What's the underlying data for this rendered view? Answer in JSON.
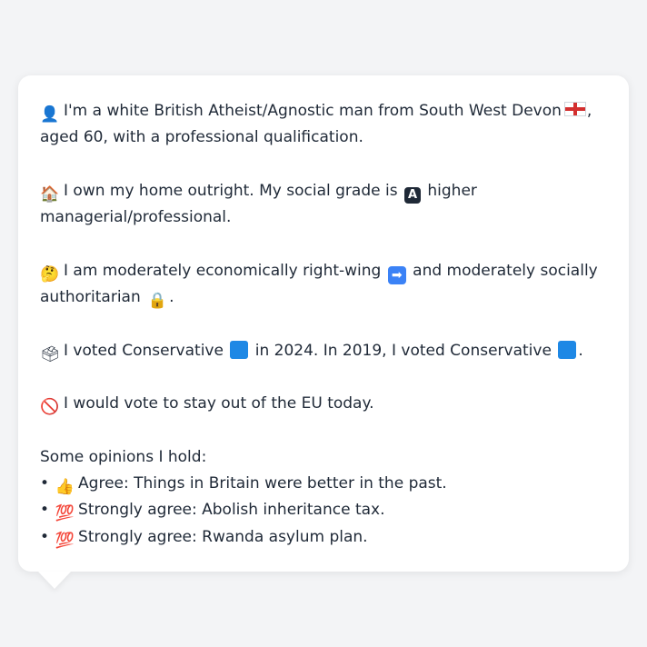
{
  "profile": {
    "line1a": "I'm a white British Atheist/Agnostic man from South West Devon",
    "line1b": ",",
    "line2": "aged 60, with a professional qualification.",
    "home_a": "I own my home outright. My social grade is",
    "home_b": "higher",
    "home_c": "managerial/professional.",
    "politics_a": "I am moderately economically right-wing",
    "politics_b": "and moderately socially",
    "politics_c": "authoritarian",
    "politics_d": ".",
    "vote_a": "I voted Conservative",
    "vote_b": "in 2024. In 2019, I voted Conservative",
    "vote_c": ".",
    "eu": "I would vote to stay out of the EU today.",
    "opinions_heading": "Some opinions I hold:",
    "opinions": [
      {
        "bullet": "•",
        "icon": "👍",
        "text": "Agree: Things in Britain were better in the past."
      },
      {
        "bullet": "•",
        "icon": "💯",
        "text": "Strongly agree: Abolish inheritance tax."
      },
      {
        "bullet": "•",
        "icon": "💯",
        "text": "Strongly agree: Rwanda asylum plan."
      }
    ]
  },
  "icons": {
    "person": "👤",
    "house": "🏠",
    "thinking": "🤔",
    "arrow": "➡",
    "lock": "🔒",
    "ballot": "🗳",
    "no_entry": "🚫",
    "grade_letter": "A"
  },
  "colors": {
    "background": "#f3f4f6",
    "bubble": "#ffffff",
    "text": "#1f2937",
    "conservative_blue": "#1e88e5"
  }
}
